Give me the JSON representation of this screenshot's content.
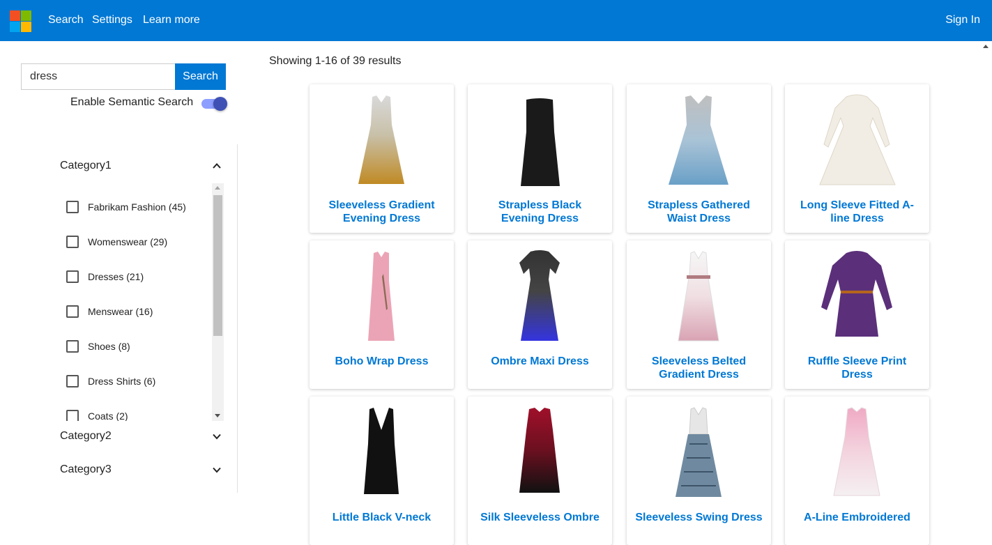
{
  "nav": {
    "logo_icon": "microsoft-logo-icon",
    "links": [
      "Search",
      "Settings",
      "Learn more"
    ],
    "sign_in": "Sign In",
    "bar_color": "#0078d4"
  },
  "search": {
    "value": "dress",
    "button_label": "Search",
    "semantic_label": "Enable Semantic Search",
    "semantic_enabled": true
  },
  "facets": {
    "category1": {
      "label": "Category1",
      "expanded": true,
      "items": [
        {
          "label": "Fabrikam Fashion (45)",
          "checked": false
        },
        {
          "label": "Womenswear (29)",
          "checked": false
        },
        {
          "label": "Dresses (21)",
          "checked": false
        },
        {
          "label": "Menswear (16)",
          "checked": false
        },
        {
          "label": "Shoes (8)",
          "checked": false
        },
        {
          "label": "Dress Shirts (6)",
          "checked": false
        },
        {
          "label": "Coats (2)",
          "checked": false
        }
      ]
    },
    "category2": {
      "label": "Category2",
      "expanded": false
    },
    "category3": {
      "label": "Category3",
      "expanded": false
    }
  },
  "results": {
    "count_text": "Showing 1-16 of 39 results",
    "products": [
      {
        "title": "Sleeveless Gradient Evening Dress",
        "image": "sleeveless-gradient-dress-image"
      },
      {
        "title": "Strapless Black Evening Dress",
        "image": "black-dress-image"
      },
      {
        "title": "Strapless Gathered Waist Dress",
        "image": "blue-gathered-dress-image"
      },
      {
        "title": "Long Sleeve Fitted A-line Dress",
        "image": "cream-aline-dress-image"
      },
      {
        "title": "Boho Wrap Dress",
        "image": "pink-wrap-dress-image"
      },
      {
        "title": "Ombre Maxi Dress",
        "image": "ombre-maxi-dress-image"
      },
      {
        "title": "Sleeveless Belted Gradient Dress",
        "image": "belted-gradient-dress-image"
      },
      {
        "title": "Ruffle Sleeve Print Dress",
        "image": "purple-print-dress-image"
      },
      {
        "title": "Little Black V-neck",
        "image": "black-vneck-dress-image"
      },
      {
        "title": "Silk Sleeveless Ombre",
        "image": "red-ombre-dress-image"
      },
      {
        "title": "Sleeveless Swing Dress",
        "image": "swing-dress-image"
      },
      {
        "title": "A-Line Embroidered",
        "image": "pink-embroidered-dress-image"
      }
    ]
  }
}
